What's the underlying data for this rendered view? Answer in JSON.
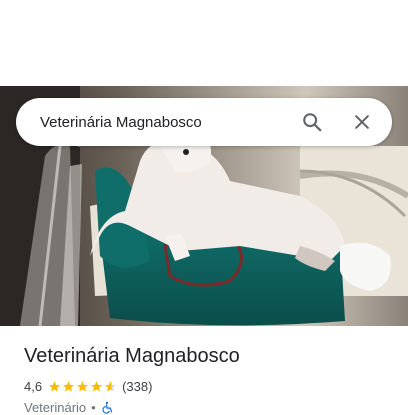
{
  "search": {
    "query": "Veterinária Magnabosco"
  },
  "place": {
    "name": "Veterinária Magnabosco",
    "rating": "4,6",
    "stars_filled": 4.6,
    "review_count": "(338)",
    "category": "Veterinário",
    "separator": "•"
  },
  "icons": {
    "search": "search-icon",
    "close": "close-icon",
    "accessibility": "wheelchair-icon"
  },
  "colors": {
    "star": "#fbbc04",
    "accessibility": "#1a73e8",
    "title": "#202124"
  }
}
